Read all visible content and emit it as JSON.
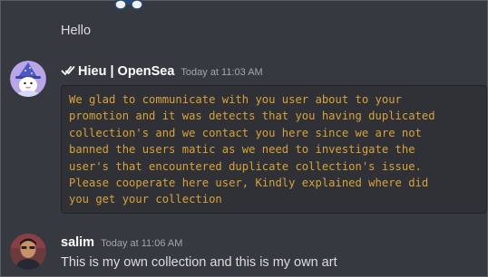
{
  "messages": {
    "hello": {
      "text": "Hello"
    },
    "opensea": {
      "author": "Hieu | OpenSea",
      "timestamp": "Today at 11:03 AM",
      "code_lines": [
        "We glad to communicate with you user about to your",
        "promotion and it was detects that you having duplicated",
        "collection's and we contact you here since we are not",
        "banned the users matic as we need to investigate the",
        "user's that encountered duplicate collection's issue.",
        "Please cooperate here user, Kindly explained where did",
        "you get your collection"
      ],
      "code_color": "#d8a23a"
    },
    "salim": {
      "author": "salim",
      "timestamp": "Today at 11:06 AM",
      "text": "This is my own collection and this is my own art"
    }
  },
  "colors": {
    "background": "#36393f",
    "codeblock_background": "#2f3136",
    "text": "#dcddde",
    "author": "#ffffff",
    "timestamp": "#a3a6aa"
  },
  "icons": {
    "verified": "checkmark-badge-icon",
    "sticker": "sticker-image"
  }
}
